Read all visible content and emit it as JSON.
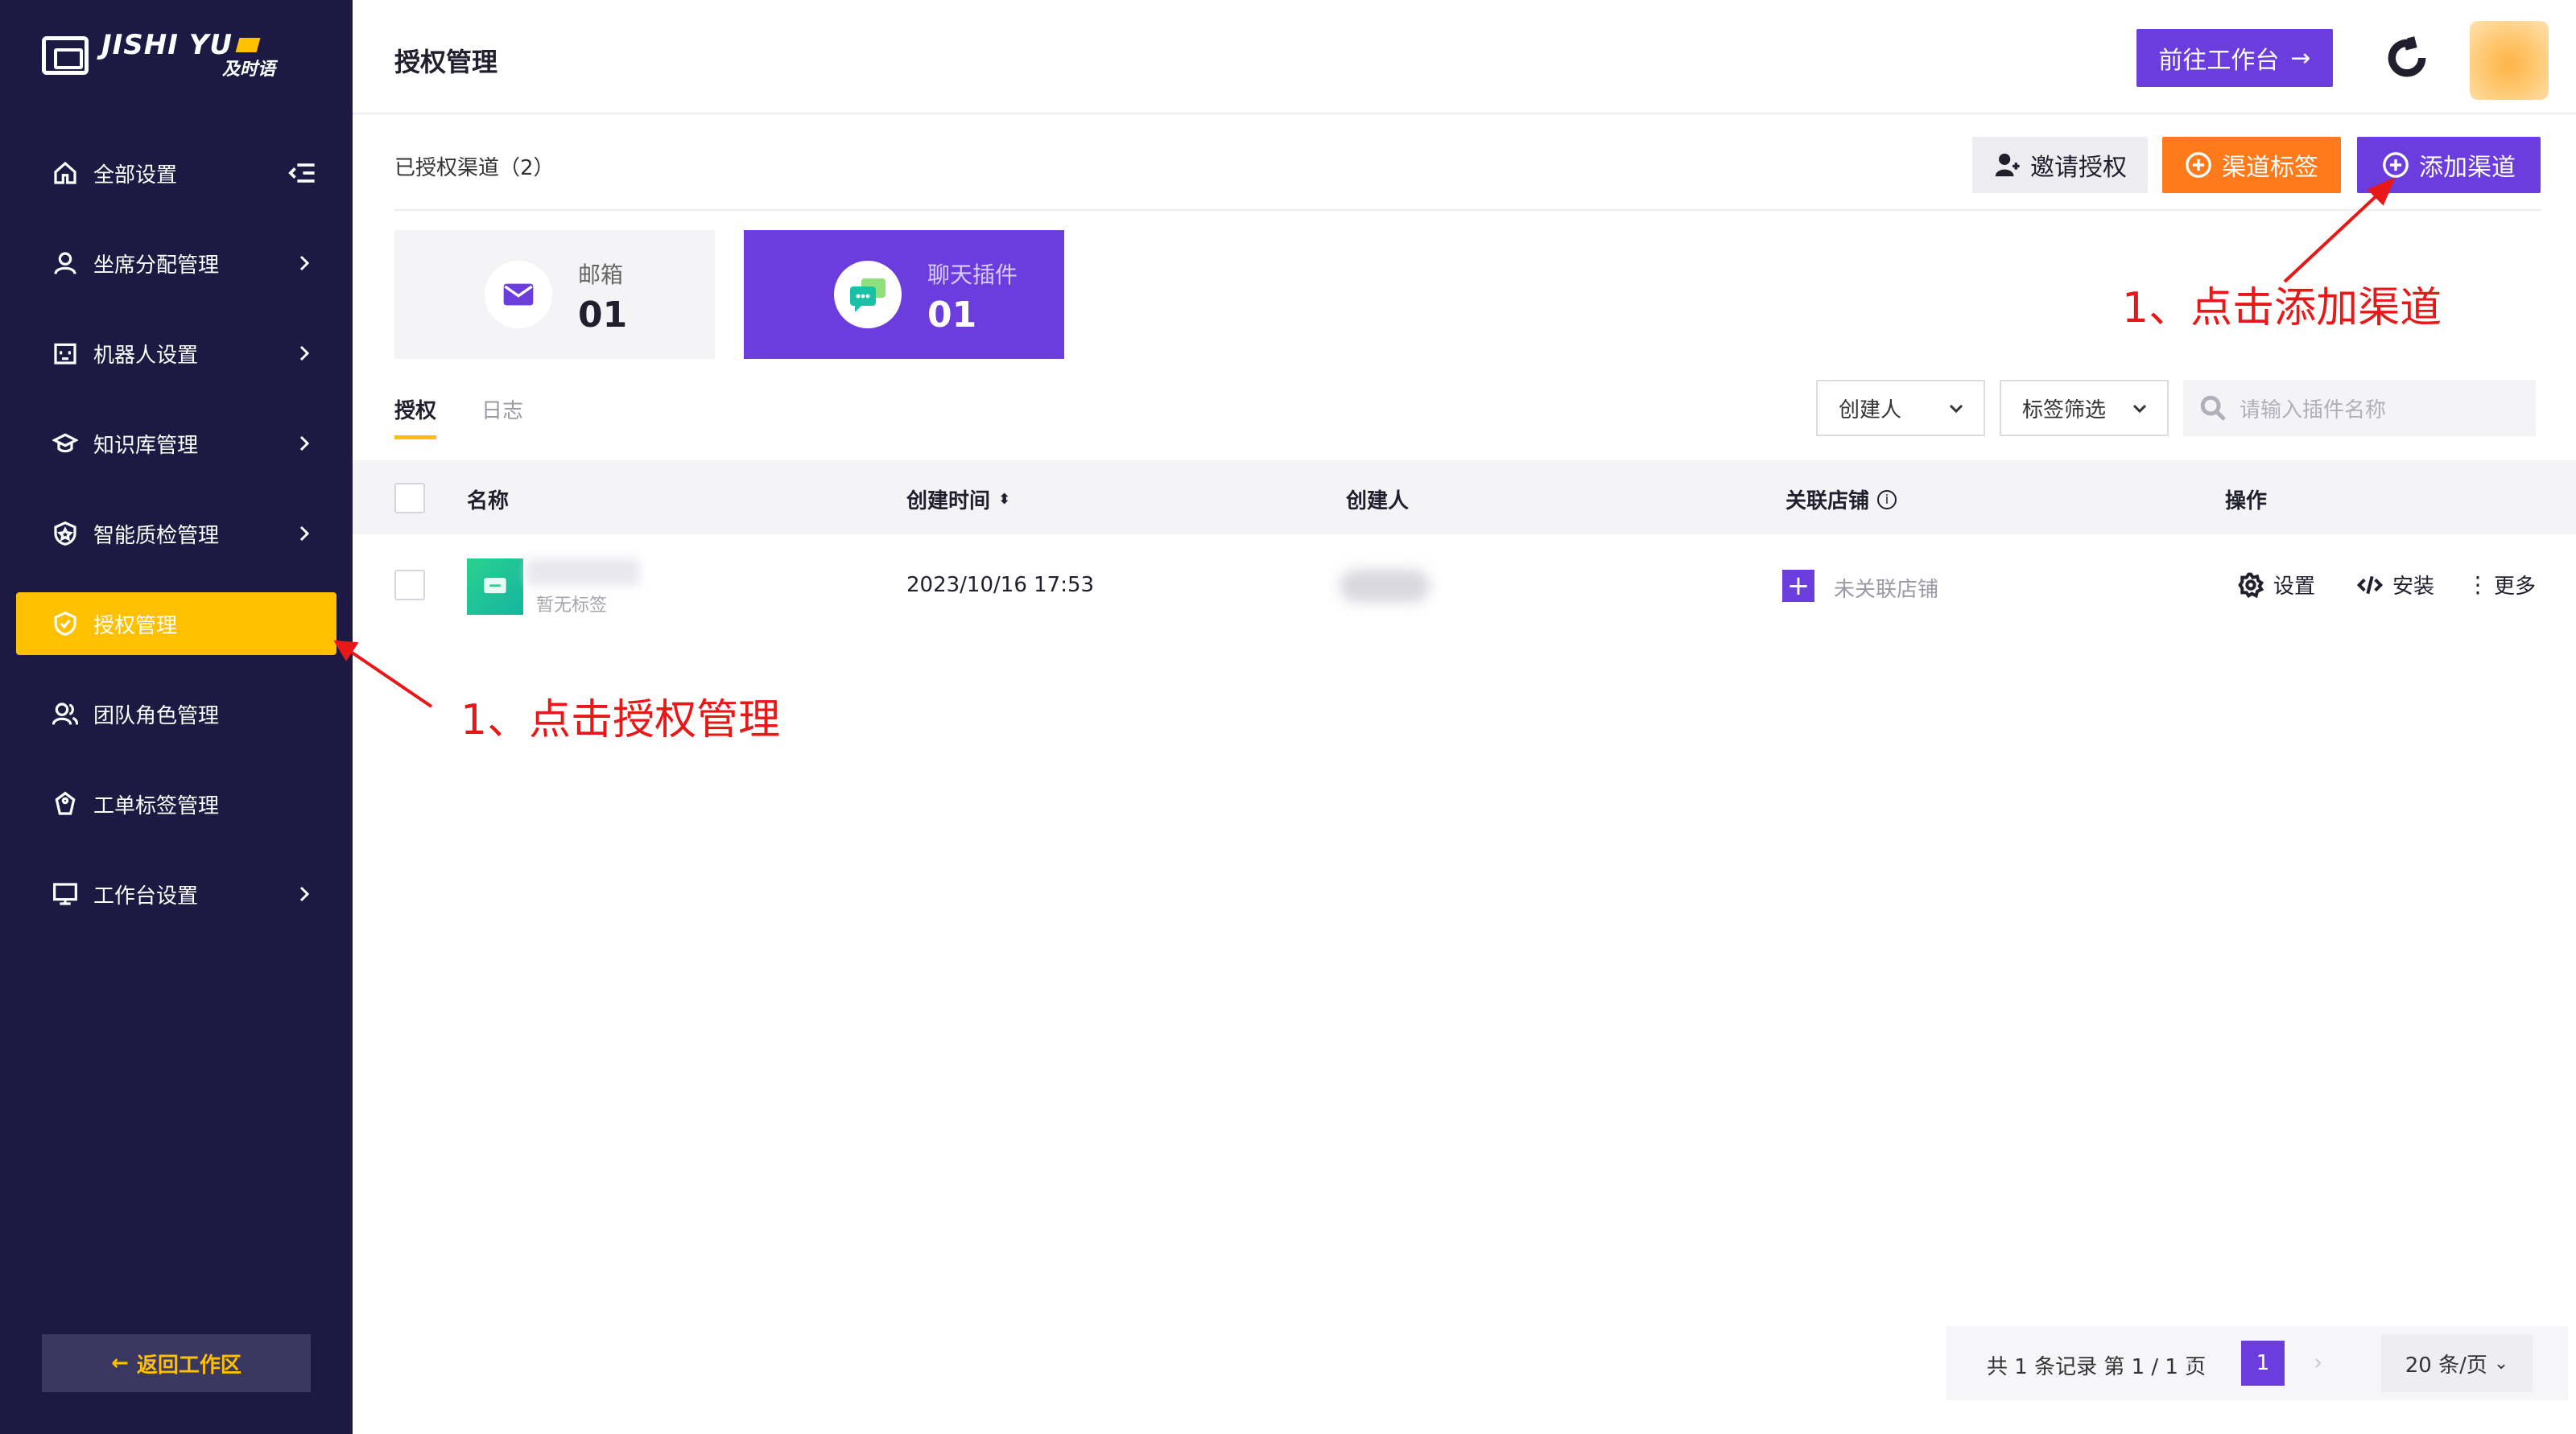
{
  "app": {
    "logo_en": "JISHI YU",
    "logo_cn": "及时语"
  },
  "sidebar": {
    "items": [
      {
        "label": "全部设置",
        "icon": "home-icon",
        "has_chevron": false
      },
      {
        "label": "坐席分配管理",
        "icon": "user-icon",
        "has_chevron": true
      },
      {
        "label": "机器人设置",
        "icon": "robot-icon",
        "has_chevron": true
      },
      {
        "label": "知识库管理",
        "icon": "graduation-cap-icon",
        "has_chevron": true
      },
      {
        "label": "智能质检管理",
        "icon": "shield-icon",
        "has_chevron": true
      },
      {
        "label": "授权管理",
        "icon": "check-badge-icon",
        "has_chevron": false,
        "active": true
      },
      {
        "label": "团队角色管理",
        "icon": "team-icon",
        "has_chevron": false
      },
      {
        "label": "工单标签管理",
        "icon": "tag-icon",
        "has_chevron": false
      },
      {
        "label": "工作台设置",
        "icon": "monitor-icon",
        "has_chevron": true
      }
    ],
    "back_label": "返回工作区"
  },
  "header": {
    "title": "授权管理",
    "goto_label": "前往工作台"
  },
  "main": {
    "authorized_count": "已授权渠道（2）",
    "buttons": {
      "invite": "邀请授权",
      "channel_tag": "渠道标签",
      "add_channel": "添加渠道"
    },
    "cards": [
      {
        "label": "邮箱",
        "count": "01",
        "icon": "mail-icon"
      },
      {
        "label": "聊天插件",
        "count": "01",
        "icon": "chat-icon"
      }
    ],
    "tabs": [
      {
        "label": "授权",
        "active": true
      },
      {
        "label": "日志",
        "active": false
      }
    ],
    "filters": {
      "creator": "创建人",
      "tag": "标签筛选",
      "search_placeholder": "请输入插件名称"
    },
    "table": {
      "columns": [
        "名称",
        "创建时间",
        "创建人",
        "关联店铺",
        "操作"
      ],
      "rows": [
        {
          "name_tag": "暂无标签",
          "created": "2023/10/16 17:53",
          "store": "未关联店铺",
          "actions": [
            "设置",
            "安装",
            "更多"
          ]
        }
      ]
    },
    "pagination": {
      "summary": "共 1 条记录 第 1 / 1 页",
      "current": "1",
      "page_size": "20 条/页"
    }
  },
  "annotations": {
    "add_channel": "1、点击添加渠道",
    "auth_manage": "1、点击授权管理"
  },
  "colors": {
    "sidebar_bg": "#1c1a43",
    "accent_purple": "#6b3cde",
    "accent_orange": "#ff7a1a",
    "active_yellow": "#ffc000",
    "annotation_red": "#e81818"
  }
}
